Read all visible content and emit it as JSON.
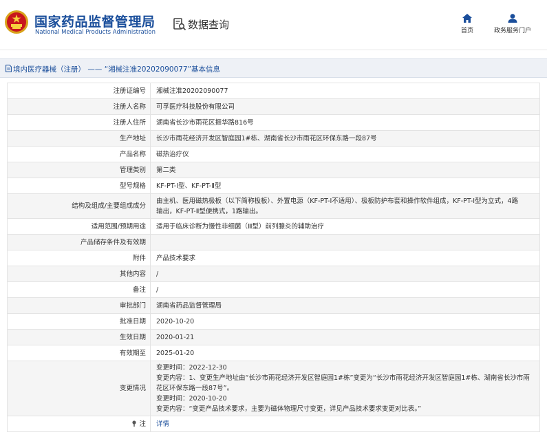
{
  "header": {
    "agency_name_cn": "国家药品监督管理局",
    "agency_name_en": "National Medical Products Administration",
    "page_title": "数据查询",
    "nav": {
      "home_label": "首页",
      "portal_label": "政务服务门户"
    },
    "icons": {
      "emblem": "national-emblem-icon",
      "query": "search-document-icon",
      "home": "home-icon",
      "portal": "user-icon"
    }
  },
  "breadcrumb": {
    "category": "境内医疗器械（注册）",
    "separator": "——",
    "record_title": "“湘械注准20202090077”基本信息"
  },
  "colors": {
    "brand_blue": "#1a4e9b",
    "row_alt": "#f5f5f5",
    "crumb_bg": "#eef1f6"
  },
  "rows": [
    {
      "label": "注册证编号",
      "value": "湘械注准20202090077"
    },
    {
      "label": "注册人名称",
      "value": "可孚医疗科技股份有限公司"
    },
    {
      "label": "注册人住所",
      "value": "湖南省长沙市雨花区振华路816号"
    },
    {
      "label": "生产地址",
      "value": "长沙市雨花经济开发区智庭园1#栋、湖南省长沙市雨花区环保东路一段87号"
    },
    {
      "label": "产品名称",
      "value": "磁热治疗仪"
    },
    {
      "label": "管理类别",
      "value": "第二类"
    },
    {
      "label": "型号规格",
      "value": "KF-PT-Ⅰ型、KF-PT-Ⅱ型"
    },
    {
      "label": "结构及组成/主要组成成分",
      "value_lines": [
        "由主机、医用磁热极板（以下简称极板）、外置电源（KF-PT-Ⅰ不适用）、极板防护布套和操作软件组成，KF-PT-Ⅰ型为立式，4路",
        "输出，KF-PT-Ⅱ型便携式，1路输出。"
      ]
    },
    {
      "label": "适用范围/预期用途",
      "value": "适用于临床诊断为慢性非细菌（Ⅲ型）前列腺炎的辅助治疗"
    },
    {
      "label": "产品储存条件及有效期",
      "value": ""
    },
    {
      "label": "附件",
      "value": "产品技术要求"
    },
    {
      "label": "其他内容",
      "value": "/"
    },
    {
      "label": "备注",
      "value": "/"
    },
    {
      "label": "审批部门",
      "value": "湖南省药品监督管理局"
    },
    {
      "label": "批准日期",
      "value": "2020-10-20"
    },
    {
      "label": "生效日期",
      "value": "2020-01-21"
    },
    {
      "label": "有效期至",
      "value": "2025-01-20"
    },
    {
      "label": "变更情况",
      "value_lines": [
        "变更时间：2022-12-30",
        "变更内容：1、变更生产地址由“长沙市雨花经济开发区智庭园1#栋”变更为“长沙市雨花经济开发区智庭园1#栋、湖南省长沙市雨",
        "花区环保东路一段87号”。",
        "变更时间：2020-10-20",
        "变更内容：“变更产品技术要求，主要为磁体物理尺寸变更，详见产品技术要求变更对比表。”"
      ]
    },
    {
      "label": "注",
      "value": "详情",
      "label_icon": "note-icon"
    }
  ]
}
